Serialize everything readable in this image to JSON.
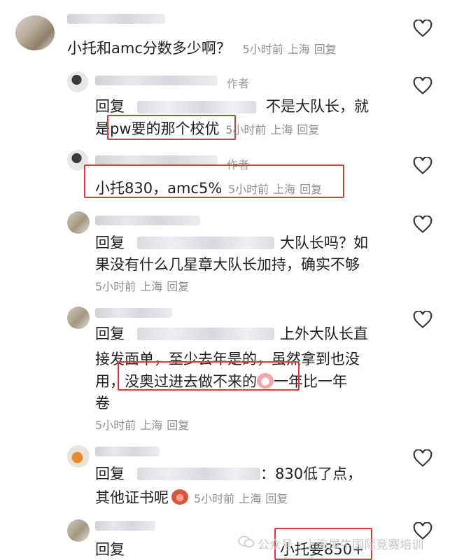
{
  "comments": [
    {
      "text": "小托和amc分数多少啊？",
      "time": "5小时前",
      "location": "上海",
      "reply_label": "回复"
    },
    {
      "author_tag": "作者",
      "prefix": "回复",
      "line1": "不是大队长，就",
      "line2_start": "是",
      "line2_highlight": "pw要的那个校优",
      "time": "5小时前",
      "location": "上海",
      "reply_label": "回复"
    },
    {
      "author_tag": "作者",
      "text": "小托830，amc5%",
      "time": "5小时前",
      "location": "上海",
      "reply_label": "回复"
    },
    {
      "prefix": "回复",
      "line1": "大队长吗？如",
      "line2": "果没有什么几星章大队长加持，确实不够",
      "time": "5小时前",
      "location": "上海",
      "reply_label": "回复"
    },
    {
      "prefix": "回复",
      "line1": "上外大队长直",
      "line2": "接发面单，至少去年是的，虽然拿到也没",
      "line3_start": "用，",
      "line3_highlight": "没奥过进去做不来的",
      "line3_end": "一年比一年",
      "line4": "卷",
      "emoji": "cry-emoji",
      "time": "5小时前",
      "location": "上海",
      "reply_label": "回复"
    },
    {
      "prefix": "回复",
      "line1": "：830低了点，",
      "line2": "其他证书呢",
      "emoji": "angry-emoji",
      "time": "5小时前",
      "location": "上海",
      "reply_label": "回复"
    },
    {
      "prefix": "回复",
      "highlight": "小托要850+"
    }
  ],
  "watermark": "公众号 · 上海犀牛国际竞赛培训",
  "colors": {
    "highlight_box": "#d93a3a",
    "meta_text": "#8f8f8f",
    "body_text": "#1f1f1f"
  },
  "icons": {
    "like": "heart-outline-icon",
    "wechat": "wechat-icon"
  }
}
